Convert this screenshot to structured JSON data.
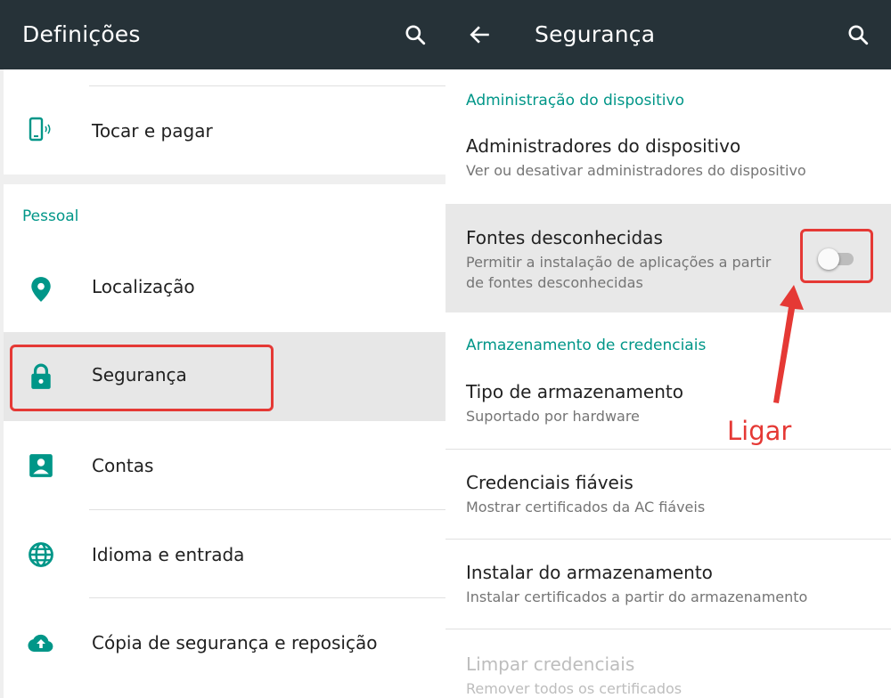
{
  "left": {
    "title": "Definições",
    "tap_pay_label": "Tocar e pagar",
    "section_personal": "Pessoal",
    "items": [
      {
        "label": "Localização",
        "icon": "location-pin-icon"
      },
      {
        "label": "Segurança",
        "icon": "lock-icon"
      },
      {
        "label": "Contas",
        "icon": "account-box-icon"
      },
      {
        "label": "Idioma e entrada",
        "icon": "globe-icon"
      },
      {
        "label": "Cópia de segurança e reposição",
        "icon": "cloud-upload-icon"
      }
    ]
  },
  "right": {
    "title": "Segurança",
    "section_device_admin": "Administração do dispositivo",
    "device_admins": {
      "title": "Administradores do dispositivo",
      "subtitle": "Ver ou desativar administradores do dispositivo"
    },
    "unknown_sources": {
      "title": "Fontes desconhecidas",
      "subtitle_line1": "Permitir a instalação de aplicações a partir",
      "subtitle_line2": "de fontes desconhecidas",
      "toggle_on": false
    },
    "section_credentials": "Armazenamento de credenciais",
    "storage_type": {
      "title": "Tipo de armazenamento",
      "subtitle": "Suportado por hardware"
    },
    "trusted_creds": {
      "title": "Credenciais fiáveis",
      "subtitle": "Mostrar certificados da AC fiáveis"
    },
    "install_storage": {
      "title": "Instalar do armazenamento",
      "subtitle": "Instalar certificados a partir do armazenamento"
    },
    "clear_creds": {
      "title": "Limpar credenciais",
      "subtitle": "Remover todos os certificados"
    }
  },
  "annotation": {
    "text": "Ligar",
    "color": "#e53935"
  },
  "colors": {
    "appbar": "#263238",
    "accent": "#009688",
    "highlight": "#e53935"
  }
}
